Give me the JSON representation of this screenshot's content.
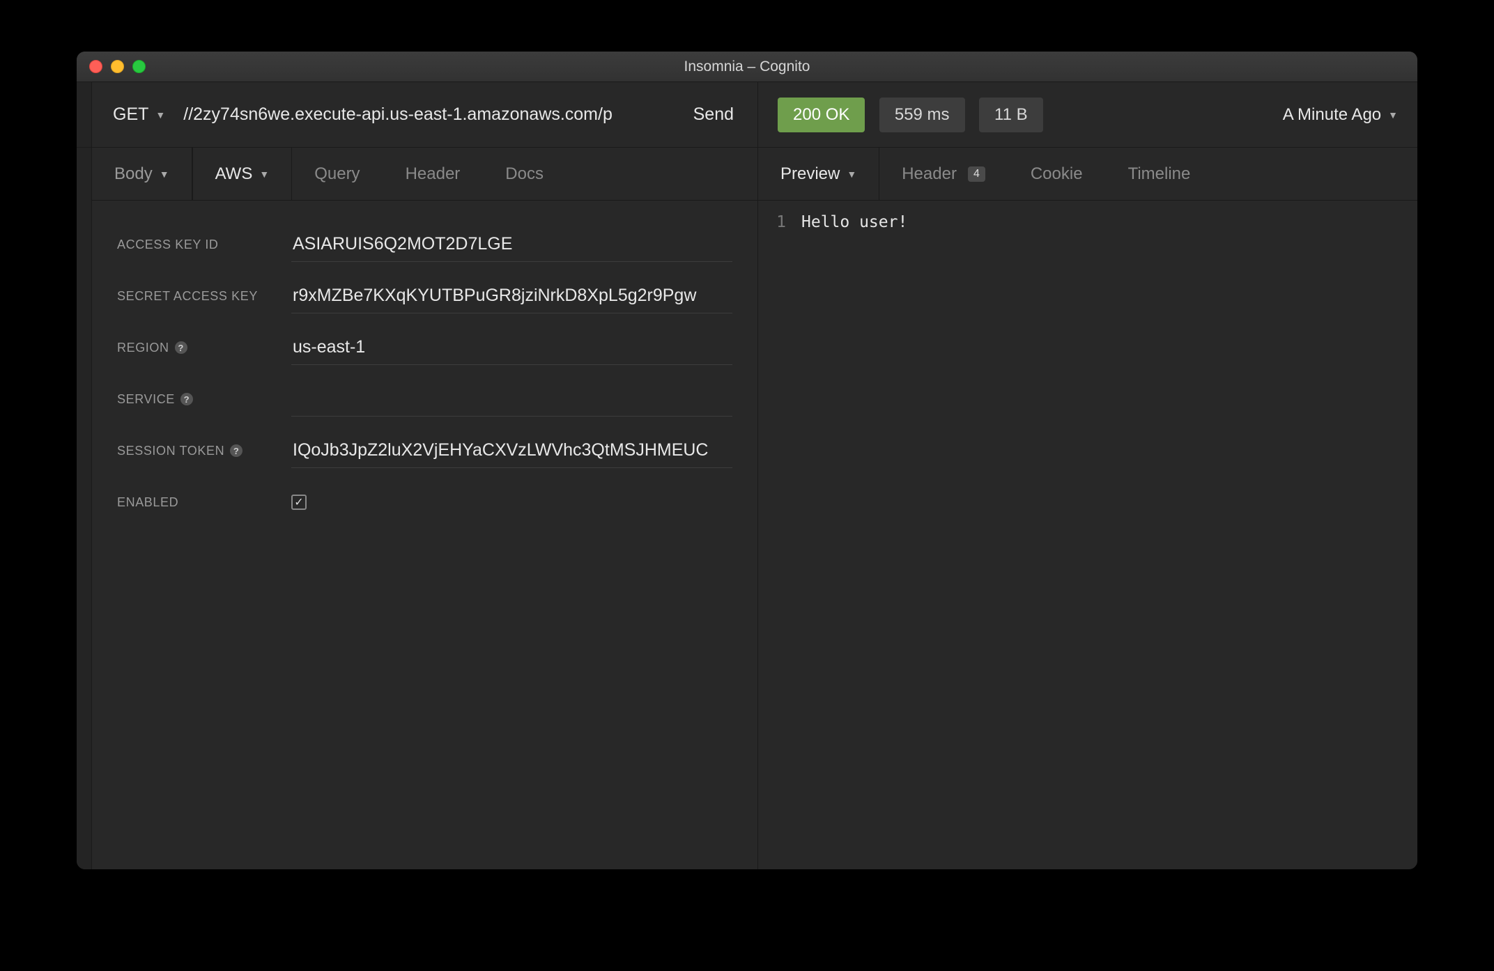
{
  "window": {
    "title": "Insomnia – Cognito"
  },
  "request": {
    "method": "GET",
    "url": "//2zy74sn6we.execute-api.us-east-1.amazonaws.com/p",
    "send_label": "Send"
  },
  "response": {
    "status": "200 OK",
    "time": "559 ms",
    "size": "11 B",
    "age": "A Minute Ago",
    "body_line_no": "1",
    "body_text": "Hello user!"
  },
  "req_tabs": {
    "body": "Body",
    "aws": "AWS",
    "query": "Query",
    "header": "Header",
    "docs": "Docs"
  },
  "resp_tabs": {
    "preview": "Preview",
    "header": "Header",
    "header_count": "4",
    "cookie": "Cookie",
    "timeline": "Timeline"
  },
  "aws_form": {
    "access_key_id_label": "ACCESS KEY ID",
    "access_key_id": "ASIARUIS6Q2MOT2D7LGE",
    "secret_access_key_label": "SECRET ACCESS KEY",
    "secret_access_key": "r9xMZBe7KXqKYUTBPuGR8jziNrkD8XpL5g2r9Pgw",
    "region_label": "REGION",
    "region": "us-east-1",
    "service_label": "SERVICE",
    "service": "",
    "session_token_label": "SESSION TOKEN",
    "session_token": "IQoJb3JpZ2luX2VjEHYaCXVzLWVhc3QtMSJHMEUC",
    "enabled_label": "ENABLED",
    "enabled": true
  }
}
